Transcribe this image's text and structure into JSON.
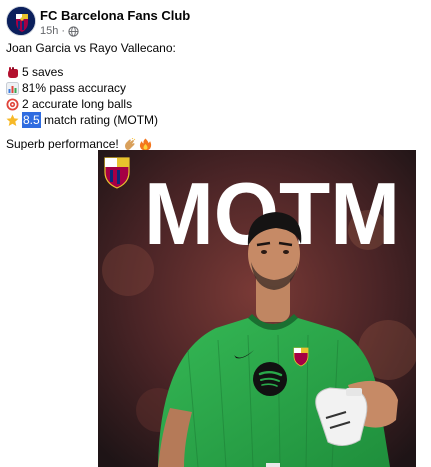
{
  "post": {
    "page_name": "FC Barcelona Fans Club",
    "time": "15h",
    "dot": "·",
    "privacy_icon": "globe-icon",
    "intro": "Joan Garcia vs Rayo Vallecano:",
    "stats": [
      {
        "icon": "glove-icon",
        "text": "5 saves"
      },
      {
        "icon": "bar-chart-icon",
        "text": "81% pass accuracy"
      },
      {
        "icon": "target-icon",
        "text": "2 accurate long balls"
      }
    ],
    "rating": {
      "icon": "star-icon",
      "value": "8.5",
      "rest": " match rating (MOTM)"
    },
    "closing": "Superb performance!",
    "closing_icons": [
      "clap-icon",
      "fire-icon"
    ]
  },
  "image": {
    "headline": "MOTM",
    "badge_icon": "fc-barcelona-crest-icon",
    "kit_logos": [
      "nike-swoosh-icon",
      "spotify-logo-icon",
      "barcelona-crest-icon"
    ],
    "colors": {
      "jersey": "#29a94a",
      "background_dark": "#2b1a1c",
      "headline": "#ffffff"
    }
  }
}
